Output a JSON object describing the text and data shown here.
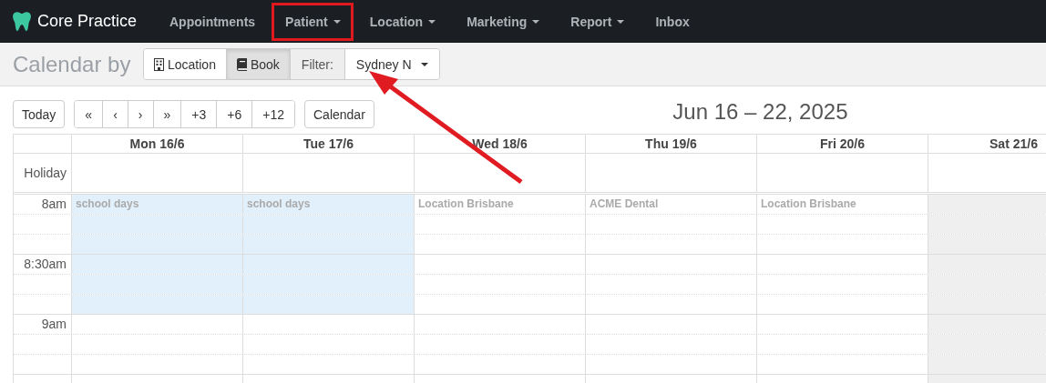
{
  "brand": {
    "name": "Core Practice"
  },
  "nav": [
    {
      "label": "Appointments",
      "dropdown": false,
      "highlighted": false
    },
    {
      "label": "Patient",
      "dropdown": true,
      "highlighted": true
    },
    {
      "label": "Location",
      "dropdown": true,
      "highlighted": false
    },
    {
      "label": "Marketing",
      "dropdown": true,
      "highlighted": false
    },
    {
      "label": "Report",
      "dropdown": true,
      "highlighted": false
    },
    {
      "label": "Inbox",
      "dropdown": false,
      "highlighted": false
    }
  ],
  "page_title": "Calendar by",
  "view_toggle": [
    {
      "label": "Location",
      "selected": false
    },
    {
      "label": "Book",
      "selected": true
    }
  ],
  "filter": {
    "label": "Filter:",
    "value": "Sydney N",
    "pointed_at": true
  },
  "toolbar": {
    "today": "Today",
    "nav_buttons": [
      "«",
      "‹",
      "›",
      "»",
      "+3",
      "+6",
      "+12"
    ],
    "calendar": "Calendar",
    "range_title": "Jun 16 – 22, 2025"
  },
  "days": [
    "Mon 16/6",
    "Tue 17/6",
    "Wed 18/6",
    "Thu 19/6",
    "Fri 20/6",
    "Sat 21/6"
  ],
  "holiday_label": "Holiday",
  "rows": [
    {
      "time": "8am",
      "cells": [
        {
          "kind": "school",
          "text": "school days"
        },
        {
          "kind": "school",
          "text": "school days"
        },
        {
          "kind": "open",
          "text": "Location Brisbane"
        },
        {
          "kind": "open",
          "text": "ACME Dental"
        },
        {
          "kind": "open",
          "text": "Location Brisbane"
        },
        {
          "kind": "closed"
        }
      ]
    },
    {
      "cells": [
        {
          "kind": "school"
        },
        {
          "kind": "school"
        },
        {
          "kind": "open"
        },
        {
          "kind": "open"
        },
        {
          "kind": "open"
        },
        {
          "kind": "closed"
        }
      ]
    },
    {
      "cells": [
        {
          "kind": "school"
        },
        {
          "kind": "school"
        },
        {
          "kind": "open"
        },
        {
          "kind": "open"
        },
        {
          "kind": "open"
        },
        {
          "kind": "closed"
        }
      ]
    },
    {
      "time": "8:30am",
      "cells": [
        {
          "kind": "school"
        },
        {
          "kind": "school"
        },
        {
          "kind": "open"
        },
        {
          "kind": "open"
        },
        {
          "kind": "open"
        },
        {
          "kind": "closed"
        }
      ]
    },
    {
      "cells": [
        {
          "kind": "school"
        },
        {
          "kind": "school"
        },
        {
          "kind": "open"
        },
        {
          "kind": "open"
        },
        {
          "kind": "open"
        },
        {
          "kind": "closed"
        }
      ]
    },
    {
      "cells": [
        {
          "kind": "school"
        },
        {
          "kind": "school"
        },
        {
          "kind": "open"
        },
        {
          "kind": "open"
        },
        {
          "kind": "open"
        },
        {
          "kind": "closed"
        }
      ]
    },
    {
      "time": "9am",
      "cells": [
        {
          "kind": "open"
        },
        {
          "kind": "open"
        },
        {
          "kind": "open"
        },
        {
          "kind": "open"
        },
        {
          "kind": "open"
        },
        {
          "kind": "closed"
        }
      ]
    },
    {
      "cells": [
        {
          "kind": "open"
        },
        {
          "kind": "open"
        },
        {
          "kind": "open"
        },
        {
          "kind": "open"
        },
        {
          "kind": "open"
        },
        {
          "kind": "closed"
        }
      ]
    },
    {
      "cells": [
        {
          "kind": "open"
        },
        {
          "kind": "open"
        },
        {
          "kind": "open"
        },
        {
          "kind": "open"
        },
        {
          "kind": "open"
        },
        {
          "kind": "closed"
        }
      ]
    },
    {
      "cells": [
        {
          "kind": "open"
        },
        {
          "kind": "open"
        },
        {
          "kind": "open"
        },
        {
          "kind": "open"
        },
        {
          "kind": "open"
        },
        {
          "kind": "closed"
        }
      ]
    }
  ]
}
